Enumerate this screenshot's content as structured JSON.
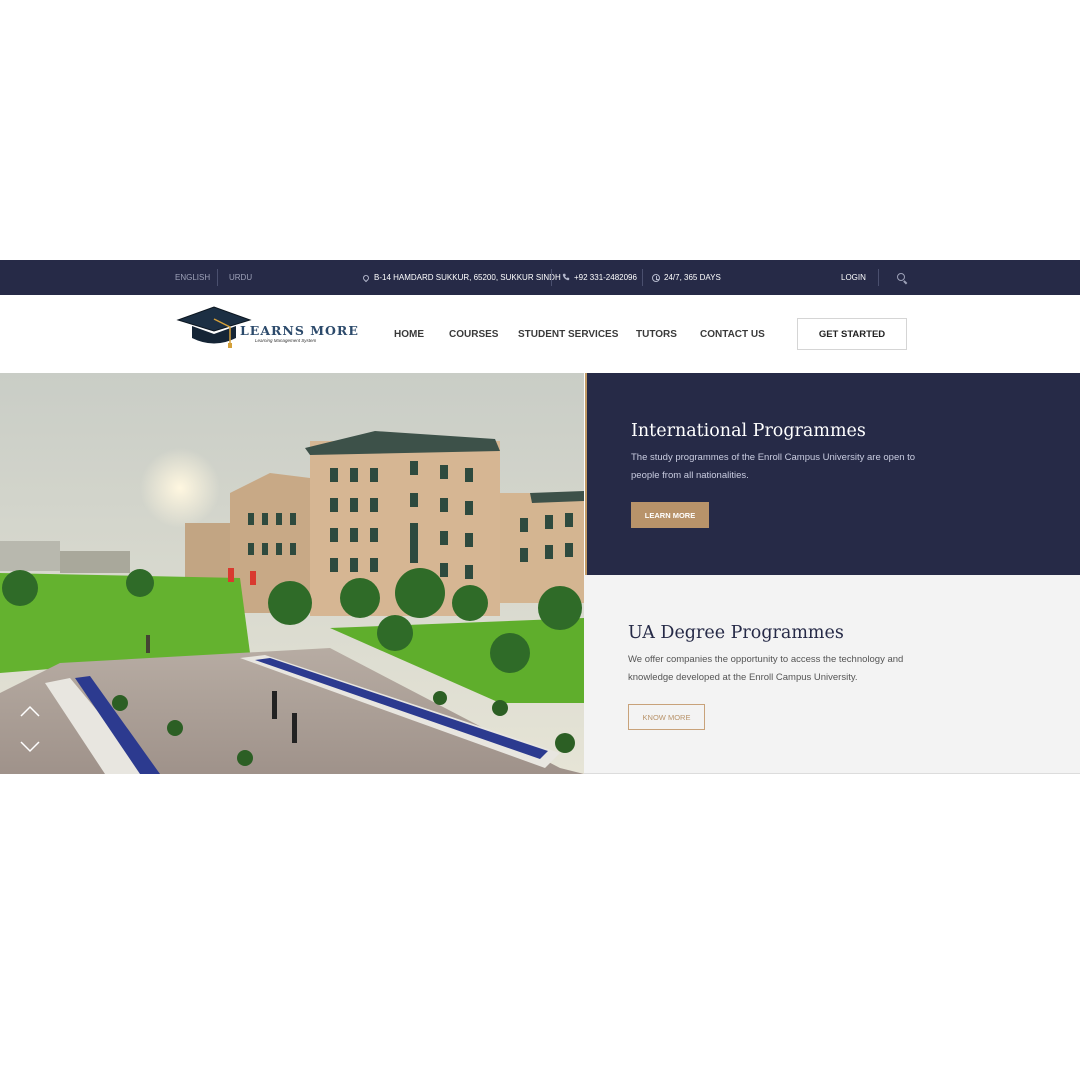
{
  "topbar": {
    "lang_english": "ENGLISH",
    "lang_urdu": "URDU",
    "address": "B-14 HAMDARD SUKKUR, 65200, SUKKUR SINDH",
    "phone": "+92 331-2482096",
    "hours": "24/7, 365 DAYS",
    "login": "LOGIN"
  },
  "header": {
    "logo_title": "LEARNS MORE",
    "logo_subtitle": "Learning Management System",
    "nav": [
      "HOME",
      "COURSES",
      "STUDENT SERVICES",
      "TUTORS",
      "CONTACT US"
    ],
    "cta": "GET STARTED"
  },
  "hero": {
    "panels": [
      {
        "title": "International Programmes",
        "text": "The study programmes of the Enroll Campus University are open to people from all nationalities.",
        "button": "LEARN MORE"
      },
      {
        "title": "UA Degree Programmes",
        "text": "We offer companies the opportunity to access the technology and knowledge developed at the Enroll Campus University.",
        "button": "KNOW MORE"
      }
    ]
  },
  "colors": {
    "navy": "#262a47",
    "gold": "#b8936a",
    "panel_light": "#f3f3f3"
  },
  "icons": [
    "map-pin-icon",
    "phone-icon",
    "clock-icon",
    "search-icon",
    "chevron-up-icon",
    "chevron-down-icon",
    "graduation-cap-icon"
  ]
}
